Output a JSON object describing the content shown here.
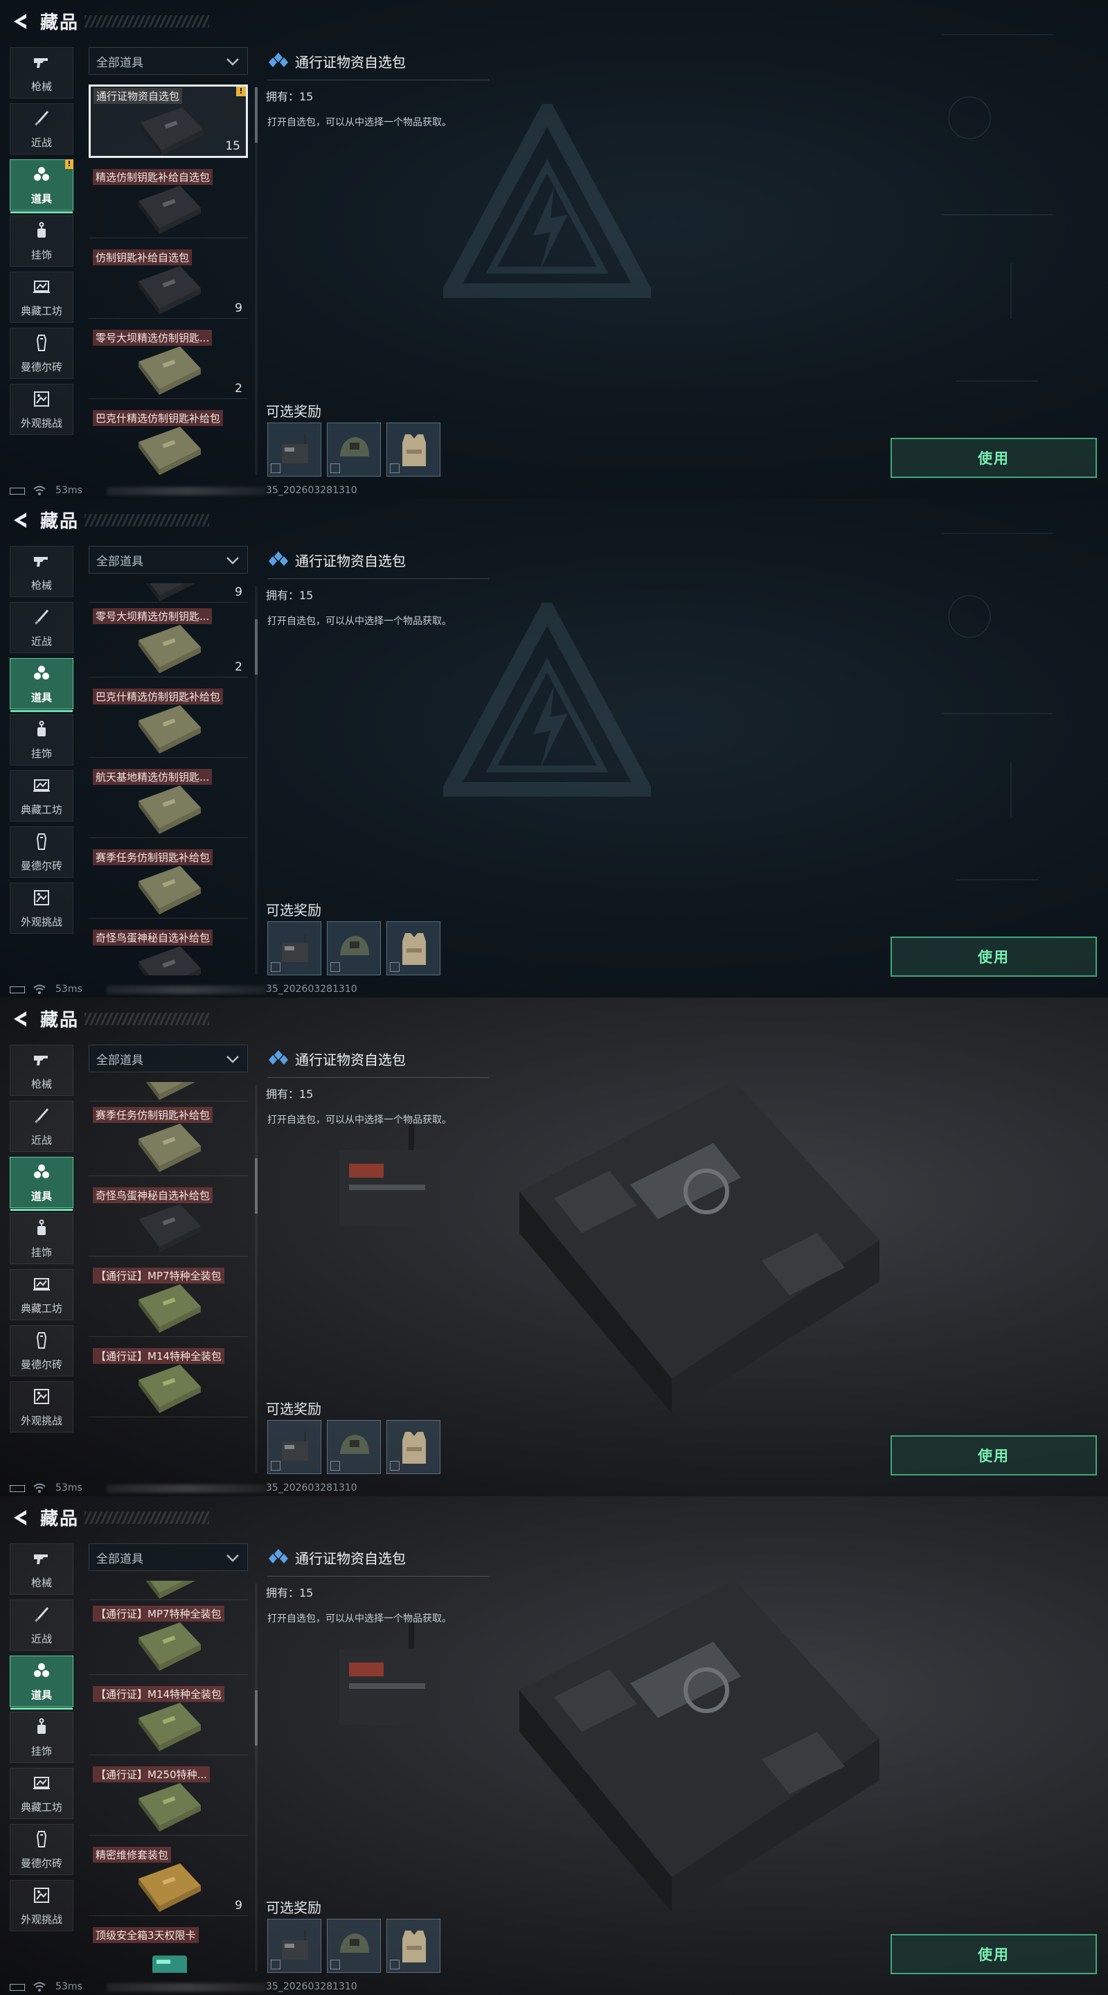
{
  "header": {
    "title": "藏品"
  },
  "categories": [
    {
      "label": "枪械",
      "icon": "gun-icon"
    },
    {
      "label": "近战",
      "icon": "knife-icon"
    },
    {
      "label": "道具",
      "icon": "props-icon"
    },
    {
      "label": "挂饰",
      "icon": "charm-icon"
    },
    {
      "label": "典藏工坊",
      "icon": "workshop-icon"
    },
    {
      "label": "曼德尔砖",
      "icon": "brick-icon"
    },
    {
      "label": "外观挑战",
      "icon": "challenge-icon"
    }
  ],
  "filter": {
    "label": "全部道具"
  },
  "detail": {
    "name": "通行证物资自选包",
    "owned": "拥有：15",
    "description": "打开自选包，可以从中选择一个物品获取。",
    "rewards_title": "可选奖励",
    "use_label": "使用"
  },
  "status": {
    "latency": "53ms",
    "version": "35_202603281310"
  },
  "colors": {
    "accent": "#3ea879",
    "selected_category": "#2a6a55",
    "badge": "#e8b23a"
  },
  "frames": [
    {
      "background": "dark",
      "scroll_fraction": 0.0,
      "cat_badge": "!",
      "items": [
        {
          "name": "通行证物资自选包",
          "count": "15",
          "selected": true,
          "badge": "!",
          "icon": "case-dark-icon"
        },
        {
          "name": "精选仿制钥匙补给自选包",
          "count": "",
          "icon": "case-dark-icon"
        },
        {
          "name": "仿制钥匙补给自选包",
          "count": "9",
          "icon": "case-dark-icon"
        },
        {
          "name": "零号大坝精选仿制钥匙...",
          "count": "2",
          "icon": "case-olive-icon"
        },
        {
          "name": "巴克什精选仿制钥匙补给包",
          "count": "",
          "icon": "case-olive-icon"
        }
      ]
    },
    {
      "background": "dark",
      "scroll_fraction": 0.1,
      "cat_badge": "",
      "items": [
        {
          "name": "",
          "count": "9",
          "icon": "case-dark-icon",
          "partial": true
        },
        {
          "name": "零号大坝精选仿制钥匙...",
          "count": "2",
          "icon": "case-olive-icon"
        },
        {
          "name": "巴克什精选仿制钥匙补给包",
          "count": "",
          "icon": "case-olive-icon"
        },
        {
          "name": "航天基地精选仿制钥匙...",
          "count": "",
          "icon": "case-olive-icon"
        },
        {
          "name": "赛季任务仿制钥匙补给包",
          "count": "",
          "icon": "case-olive-icon"
        },
        {
          "name": "奇怪鸟蛋神秘自选补给包",
          "count": "",
          "icon": "case-dark-icon"
        }
      ]
    },
    {
      "background": "photo",
      "scroll_fraction": 0.22,
      "cat_badge": "",
      "items": [
        {
          "name": "",
          "count": "",
          "icon": "case-olive-icon",
          "partial": true
        },
        {
          "name": "赛季任务仿制钥匙补给包",
          "count": "",
          "icon": "case-olive-icon"
        },
        {
          "name": "奇怪鸟蛋神秘自选补给包",
          "count": "",
          "icon": "case-dark-icon"
        },
        {
          "name": "【通行证】MP7特种全装包",
          "count": "",
          "icon": "case-green-icon"
        },
        {
          "name": "【通行证】M14特种全装包",
          "count": "",
          "icon": "case-green-icon"
        }
      ]
    },
    {
      "background": "photo",
      "scroll_fraction": 0.32,
      "cat_badge": "",
      "items": [
        {
          "name": "",
          "count": "",
          "icon": "case-green-icon",
          "partial": true
        },
        {
          "name": "【通行证】MP7特种全装包",
          "count": "",
          "icon": "case-green-icon"
        },
        {
          "name": "【通行证】M14特种全装包",
          "count": "",
          "icon": "case-green-icon"
        },
        {
          "name": "【通行证】M250特种...",
          "count": "",
          "icon": "case-green-icon"
        },
        {
          "name": "精密维修套装包",
          "count": "9",
          "icon": "case-tan-icon"
        },
        {
          "name": "顶级安全箱3天权限卡",
          "count": "",
          "icon": "card-icon"
        }
      ]
    }
  ],
  "rewards": [
    {
      "icon": "radio-icon"
    },
    {
      "icon": "helmet-icon"
    },
    {
      "icon": "armor-vest-icon"
    }
  ]
}
